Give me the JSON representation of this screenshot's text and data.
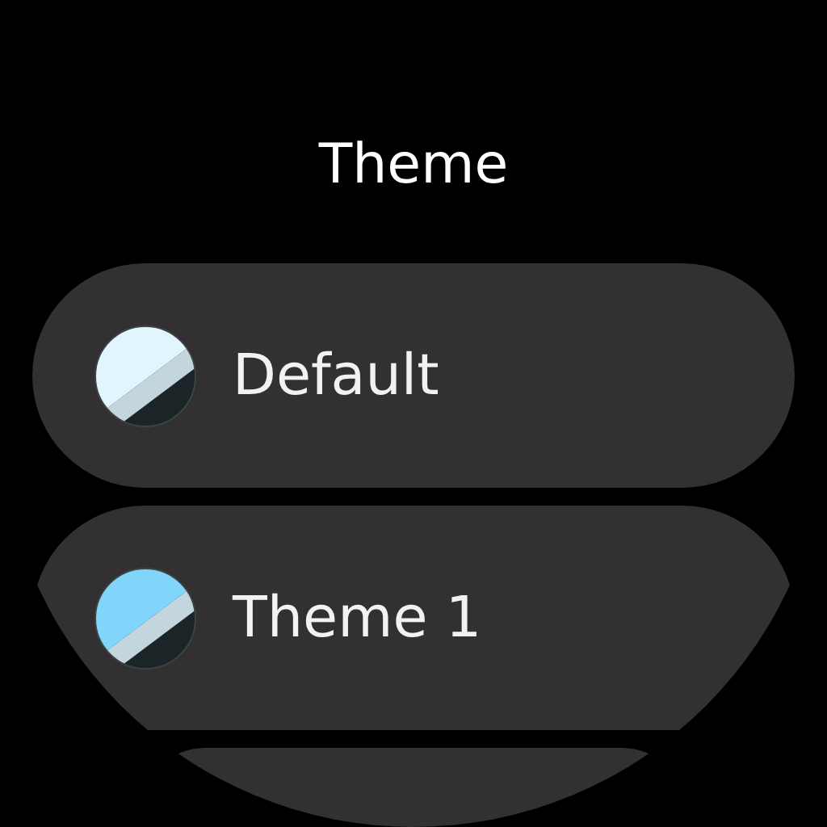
{
  "title": "Theme",
  "themes": [
    {
      "label": "Default",
      "color": "#e1f5fe"
    },
    {
      "label": "Theme 1",
      "color": "#81d4fa"
    }
  ],
  "more_chip": {
    "kind": "partial"
  }
}
